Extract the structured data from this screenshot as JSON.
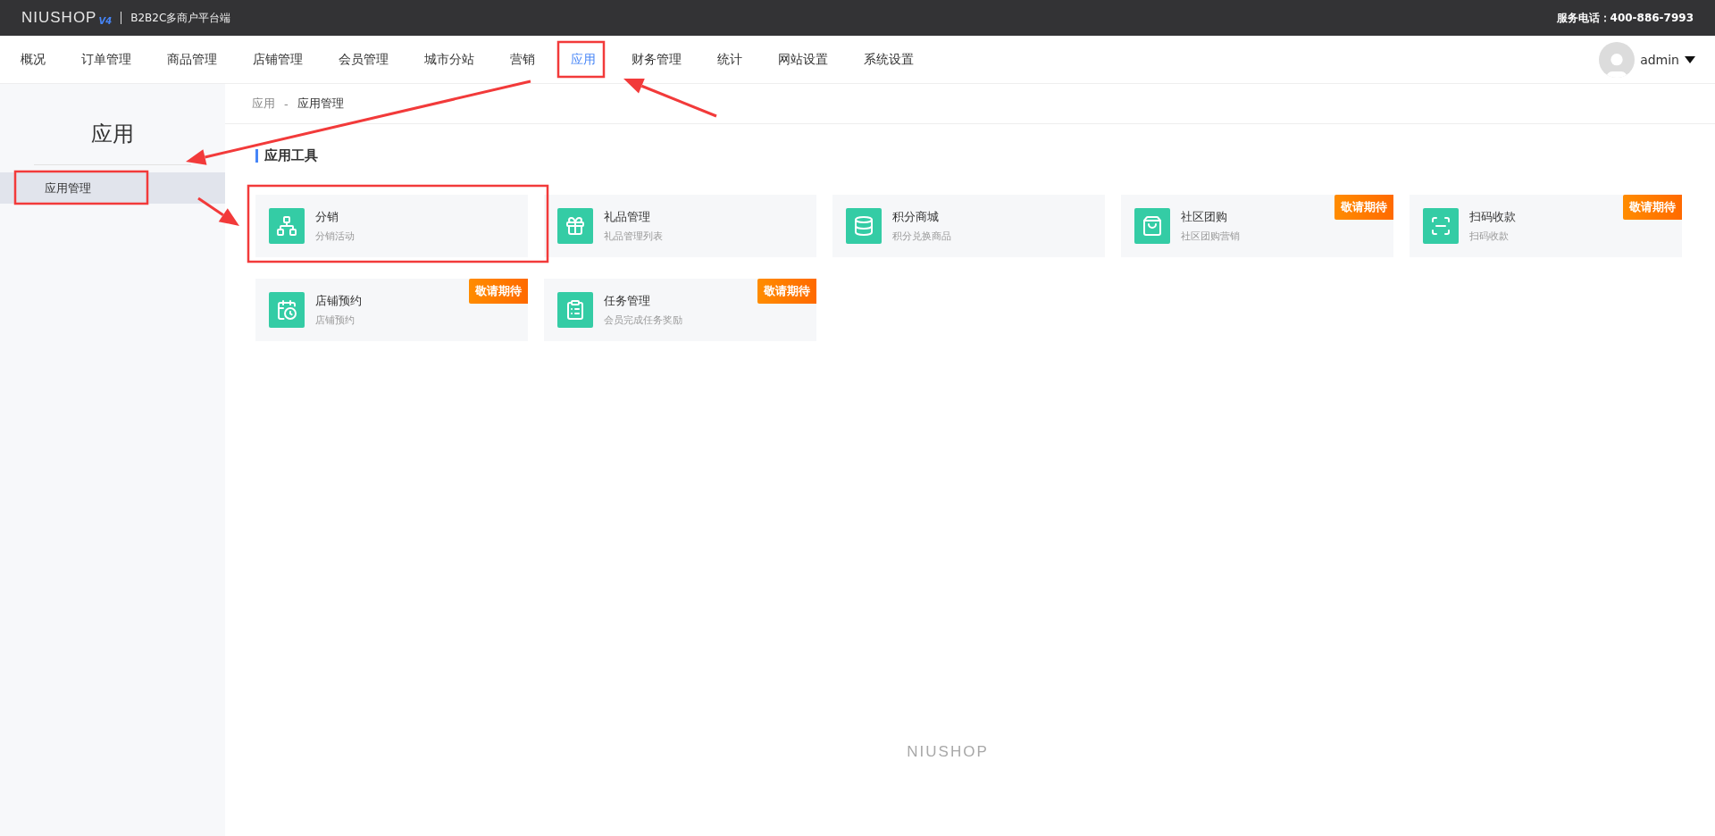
{
  "topbar": {
    "logo": "NIUSHOP",
    "version": "V4",
    "platform": "B2B2C多商户平台端",
    "hotline": "服务电话：400-886-7993"
  },
  "nav": [
    {
      "label": "概况",
      "selected": false
    },
    {
      "label": "订单管理",
      "selected": false
    },
    {
      "label": "商品管理",
      "selected": false
    },
    {
      "label": "店铺管理",
      "selected": false
    },
    {
      "label": "会员管理",
      "selected": false
    },
    {
      "label": "城市分站",
      "selected": false
    },
    {
      "label": "营销",
      "selected": false
    },
    {
      "label": "应用",
      "selected": true
    },
    {
      "label": "财务管理",
      "selected": false
    },
    {
      "label": "统计",
      "selected": false
    },
    {
      "label": "网站设置",
      "selected": false
    },
    {
      "label": "系统设置",
      "selected": false
    }
  ],
  "user": {
    "name": "admin"
  },
  "sidebar": {
    "title": "应用",
    "items": [
      {
        "label": "应用管理",
        "selected": true
      }
    ]
  },
  "breadcrumb": [
    "应用",
    "应用管理"
  ],
  "section_title": "应用工具",
  "apps": [
    {
      "kind": "network",
      "title": "分销",
      "desc": "分销活动"
    },
    {
      "kind": "gift",
      "title": "礼品管理",
      "desc": "礼品管理列表"
    },
    {
      "kind": "coins",
      "title": "积分商城",
      "desc": "积分兑换商品"
    },
    {
      "kind": "bag",
      "title": "社区团购",
      "desc": "社区团购营销",
      "badge": "敬请期待"
    },
    {
      "kind": "scan",
      "title": "扫码收款",
      "desc": "扫码收款",
      "badge": "敬请期待"
    },
    {
      "kind": "calendar",
      "title": "店铺预约",
      "desc": "店铺预约",
      "badge": "敬请期待"
    },
    {
      "kind": "clipboard",
      "title": "任务管理",
      "desc": "会员完成任务奖励",
      "badge": "敬请期待"
    }
  ],
  "breadcrumb_separator": "-",
  "footer_logo": "NIUSHOP"
}
